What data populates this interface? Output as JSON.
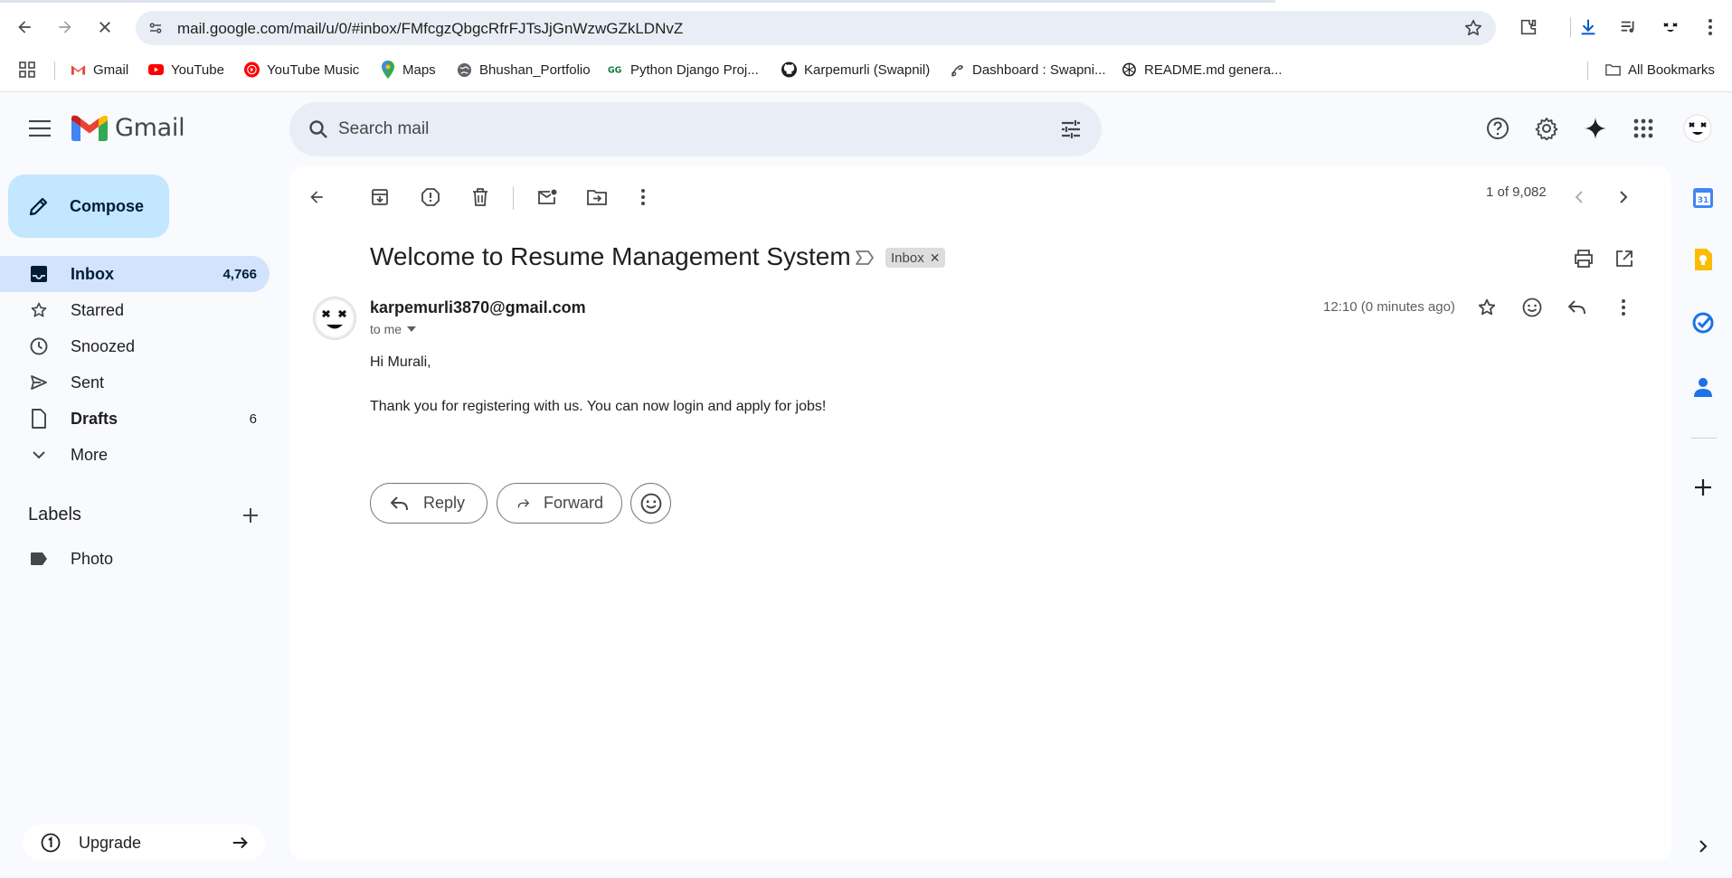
{
  "browser": {
    "url": "mail.google.com/mail/u/0/#inbox/FMfcgzQbgcRfrFJTsJjGnWzwGZkLDNvZ",
    "bookmarks": [
      {
        "label": "Gmail",
        "icon": "gmail-icon"
      },
      {
        "label": "YouTube",
        "icon": "youtube-icon"
      },
      {
        "label": "YouTube Music",
        "icon": "youtube-music-icon"
      },
      {
        "label": "Maps",
        "icon": "maps-icon"
      },
      {
        "label": "Bhushan_Portfolio",
        "icon": "globe-icon"
      },
      {
        "label": "Python Django Proj...",
        "icon": "django-icon"
      },
      {
        "label": "Karpemurli (Swapnil)",
        "icon": "github-icon"
      },
      {
        "label": "Dashboard : Swapni...",
        "icon": "dashboard-icon"
      },
      {
        "label": "README.md genera...",
        "icon": "openai-icon"
      }
    ],
    "all_bookmarks": "All Bookmarks"
  },
  "gmail": {
    "logo_text": "Gmail",
    "search_placeholder": "Search mail"
  },
  "sidebar": {
    "compose": "Compose",
    "items": [
      {
        "label": "Inbox",
        "count": "4,766",
        "icon": "inbox-icon"
      },
      {
        "label": "Starred",
        "count": "",
        "icon": "star-icon"
      },
      {
        "label": "Snoozed",
        "count": "",
        "icon": "clock-icon"
      },
      {
        "label": "Sent",
        "count": "",
        "icon": "send-icon"
      },
      {
        "label": "Drafts",
        "count": "6",
        "icon": "draft-icon"
      },
      {
        "label": "More",
        "count": "",
        "icon": "chevron-down-icon"
      }
    ],
    "labels_title": "Labels",
    "labels": [
      {
        "label": "Photo",
        "icon": "label-icon"
      }
    ],
    "upgrade": "Upgrade"
  },
  "email": {
    "pager": "1 of 9,082",
    "subject": "Welcome to Resume Management System",
    "label_chip": "Inbox",
    "sender": "karpemurli3870@gmail.com",
    "to": "to me",
    "time": "12:10 (0 minutes ago)",
    "body": [
      "Hi Murali,",
      "Thank you for registering with us. You can now login and apply for jobs!"
    ],
    "reply": "Reply",
    "forward": "Forward"
  },
  "colors": {
    "compose_bg": "#c2e7ff",
    "active_nav_bg": "#d3e3fd",
    "page_bg": "#f8fafd",
    "search_bg": "#e9eef6"
  }
}
